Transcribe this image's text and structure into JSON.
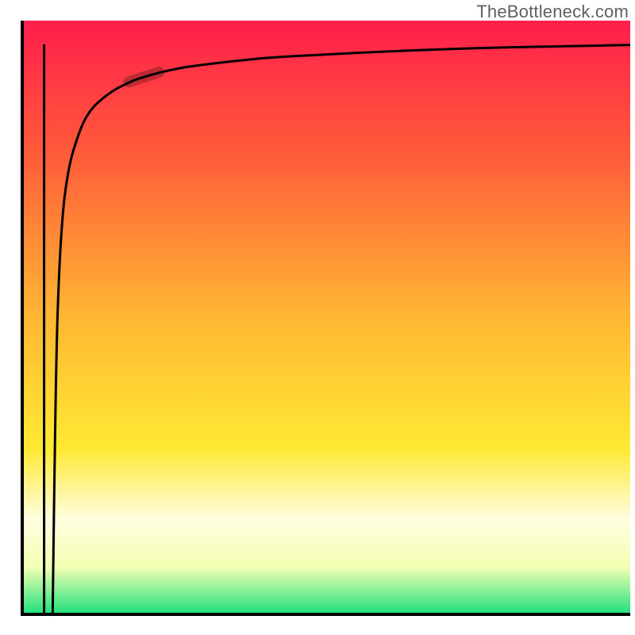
{
  "attribution": "TheBottleneck.com",
  "chart_data": {
    "type": "line",
    "title": "",
    "xlabel": "",
    "ylabel": "",
    "xlim": [
      0,
      100
    ],
    "ylim": [
      0,
      100
    ],
    "grid": false,
    "gradient_stops": [
      {
        "offset": 0,
        "color": "#ff1e4c"
      },
      {
        "offset": 22,
        "color": "#ff5a3a"
      },
      {
        "offset": 50,
        "color": "#ffb733"
      },
      {
        "offset": 72,
        "color": "#ffe933"
      },
      {
        "offset": 84,
        "color": "#fffde0"
      },
      {
        "offset": 92,
        "color": "#f4ffb3"
      },
      {
        "offset": 100,
        "color": "#1de07d"
      }
    ],
    "series": [
      {
        "name": "curve-start",
        "x": [
          3.6,
          3.6
        ],
        "y": [
          0,
          96
        ]
      },
      {
        "name": "curve-main",
        "x": [
          5.0,
          5.4,
          5.8,
          6.5,
          7.5,
          9.0,
          11.0,
          14.0,
          17.0,
          20.0,
          25.0,
          30.0,
          40.0,
          50.0,
          60.0,
          70.0,
          80.0,
          90.0,
          100.0
        ],
        "y": [
          0,
          30.0,
          50.0,
          65.0,
          74.0,
          80.0,
          84.5,
          87.5,
          89.3,
          90.5,
          91.8,
          92.6,
          93.7,
          94.3,
          94.8,
          95.2,
          95.5,
          95.7,
          95.9
        ]
      }
    ],
    "marker": {
      "x": 20.0,
      "y": 90.5,
      "angle_deg": 18
    }
  }
}
